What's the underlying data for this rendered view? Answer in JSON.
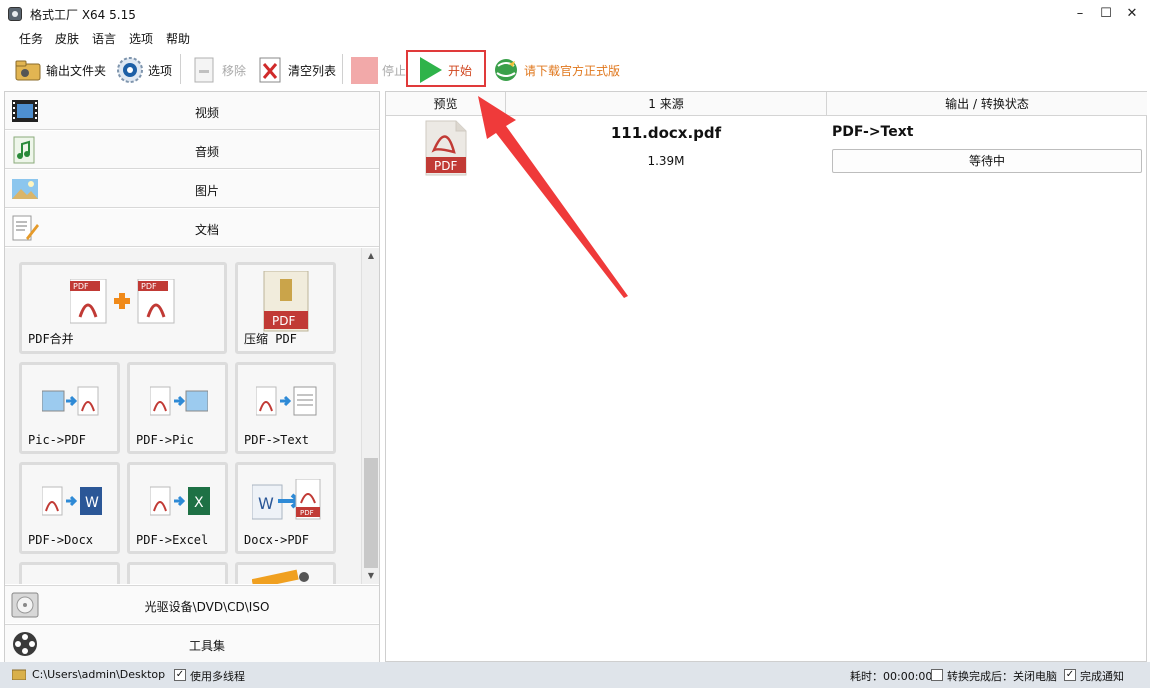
{
  "window": {
    "title": "格式工厂 X64 5.15",
    "controls": {
      "minimize": "–",
      "maximize": "☐",
      "close": "✕"
    }
  },
  "menu": [
    "任务",
    "皮肤",
    "语言",
    "选项",
    "帮助"
  ],
  "toolbar": {
    "output_folder": "输出文件夹",
    "options": "选项",
    "remove": "移除",
    "clear_list": "清空列表",
    "stop": "停止",
    "start": "开始",
    "download": "请下载官方正式版"
  },
  "categories": {
    "video": "视频",
    "audio": "音频",
    "image": "图片",
    "document": "文档",
    "disc": "光驱设备\\DVD\\CD\\ISO",
    "tools": "工具集"
  },
  "tiles": [
    {
      "label": "PDF合并"
    },
    {
      "label": "压缩 PDF"
    },
    {
      "label": "Pic->PDF"
    },
    {
      "label": "PDF->Pic"
    },
    {
      "label": "PDF->Text"
    },
    {
      "label": "PDF->Docx"
    },
    {
      "label": "PDF->Excel"
    },
    {
      "label": "Docx->PDF"
    }
  ],
  "task_list": {
    "columns": [
      "预览",
      "1 来源",
      "输出 / 转换状态"
    ],
    "rows": [
      {
        "preview_icon": "pdf-file-icon",
        "file_name": "111.docx.pdf",
        "file_size": "1.39M",
        "output_type": "PDF->Text",
        "status": "等待中"
      }
    ]
  },
  "statusbar": {
    "path": "C:\\Users\\admin\\Desktop",
    "multithread_label": "使用多线程",
    "multithread_checked": true,
    "elapsed": "耗时：00:00:00",
    "after_done_label": "转换完成后：关闭电脑",
    "after_done_checked": false,
    "notify_label": "完成通知",
    "notify_checked": true
  },
  "colors": {
    "accent_red": "#e03a3a",
    "start_green": "#2fb34a",
    "download_orange": "#e0781e",
    "pdf_red": "#c13a35",
    "statusbar_bg": "#dfe4ea"
  }
}
